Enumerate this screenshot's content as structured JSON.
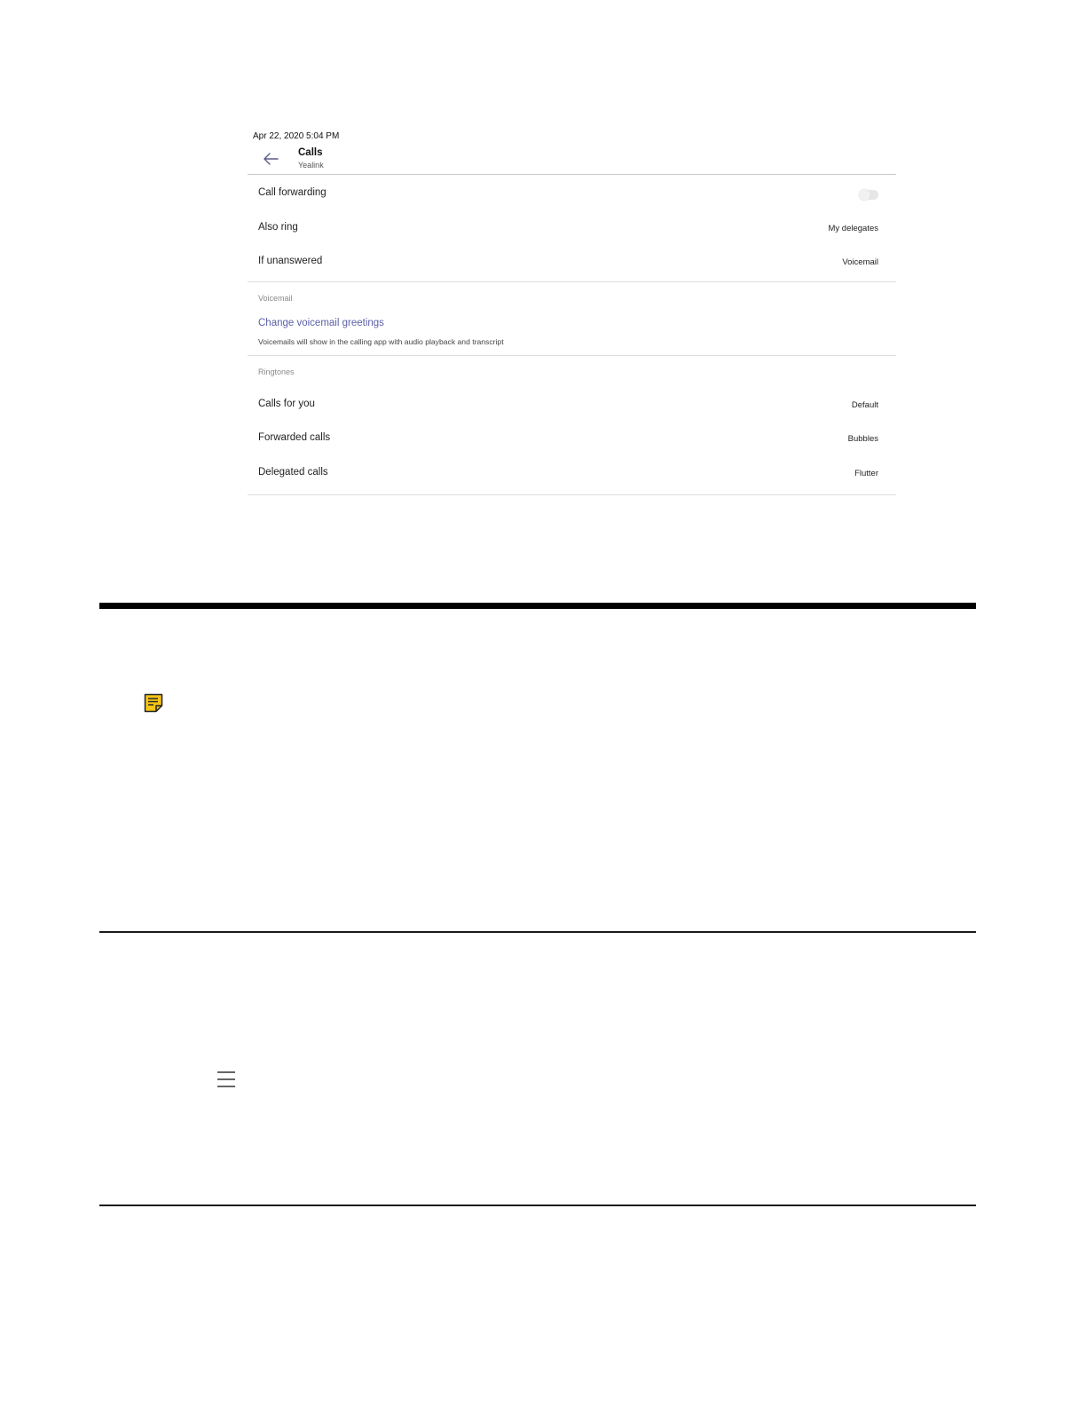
{
  "screen": {
    "status_time": "Apr 22, 2020  5:04 PM",
    "header": {
      "title": "Calls",
      "subtitle": "Yealink"
    },
    "call_settings": [
      {
        "label": "Call forwarding",
        "toggle": false
      },
      {
        "label": "Also ring",
        "value": "My delegates"
      },
      {
        "label": "If unanswered",
        "value": "Voicemail"
      }
    ],
    "voicemail": {
      "heading": "Voicemail",
      "link": "Change voicemail greetings",
      "description": "Voicemails will show in the calling app with audio playback and transcript"
    },
    "ringtones": {
      "heading": "Ringtones",
      "items": [
        {
          "label": "Calls for you",
          "value": "Default"
        },
        {
          "label": "Forwarded calls",
          "value": "Bubbles"
        },
        {
          "label": "Delegated calls",
          "value": "Flutter"
        }
      ]
    }
  },
  "icons": {
    "note": "note-icon",
    "menu": "menu-icon",
    "back": "back-arrow-icon"
  },
  "colors": {
    "note_icon_fill": "#f5c518",
    "link_color": "#5b5fa8"
  }
}
